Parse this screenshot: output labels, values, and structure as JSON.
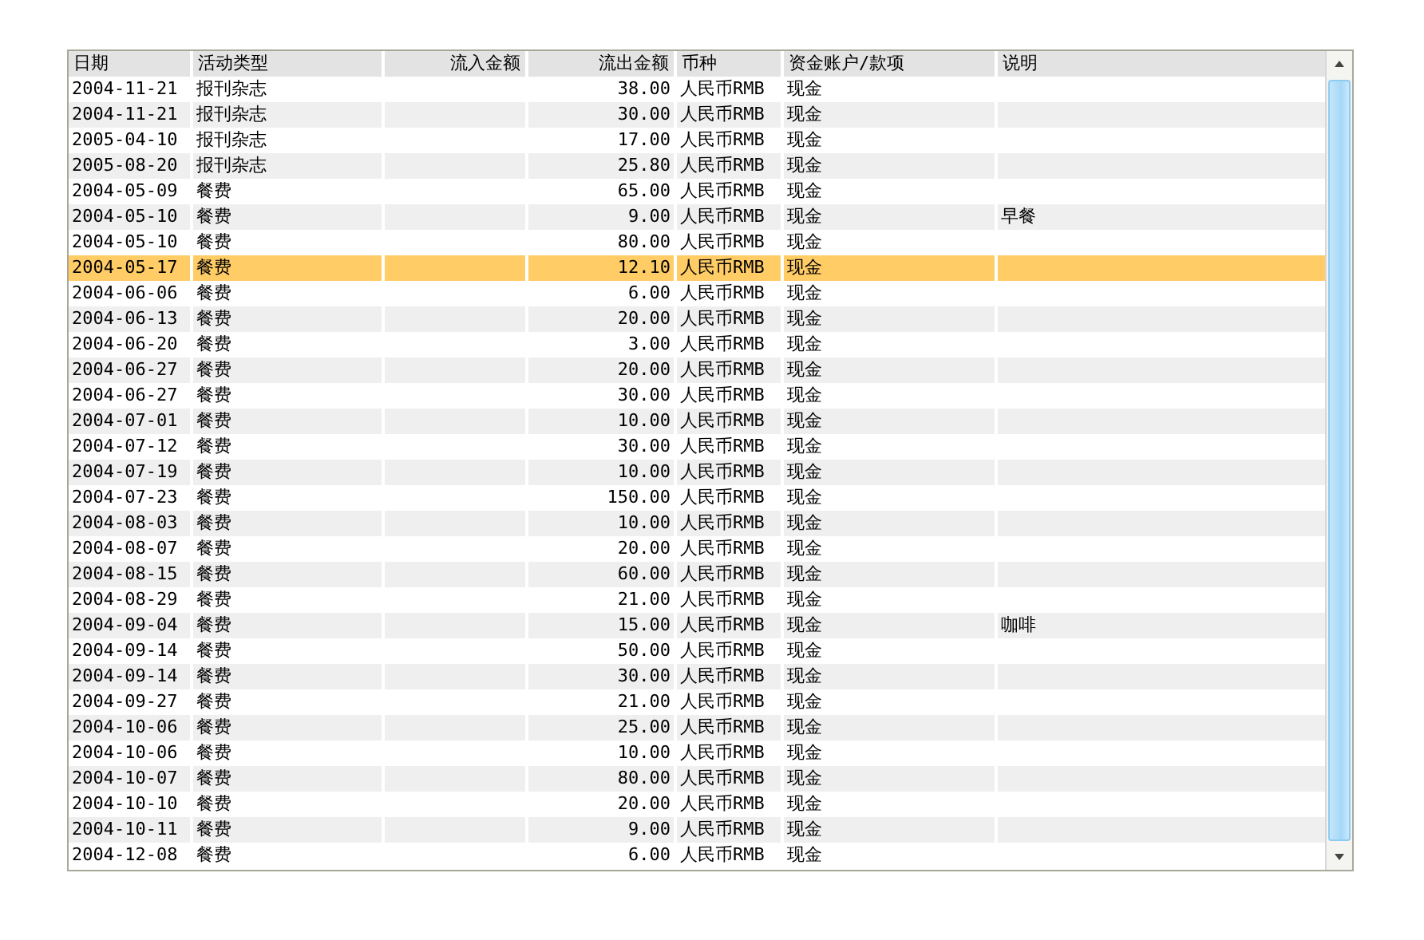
{
  "table": {
    "columns": [
      "日期",
      "活动类型",
      "流入金额",
      "流出金额",
      "币种",
      "资金账户/款项",
      "说明"
    ],
    "rows": [
      {
        "selected": false,
        "date": "2004-11-21",
        "type": "报刊杂志",
        "outflow": "38.00",
        "currency": "人民币RMB",
        "account": "现金"
      },
      {
        "selected": false,
        "date": "2004-11-21",
        "type": "报刊杂志",
        "outflow": "30.00",
        "currency": "人民币RMB",
        "account": "现金"
      },
      {
        "selected": false,
        "date": "2005-04-10",
        "type": "报刊杂志",
        "outflow": "17.00",
        "currency": "人民币RMB",
        "account": "现金"
      },
      {
        "selected": false,
        "date": "2005-08-20",
        "type": "报刊杂志",
        "outflow": "25.80",
        "currency": "人民币RMB",
        "account": "现金"
      },
      {
        "selected": false,
        "date": "2004-05-09",
        "type": "餐费",
        "outflow": "65.00",
        "currency": "人民币RMB",
        "account": "现金"
      },
      {
        "selected": false,
        "date": "2004-05-10",
        "type": "餐费",
        "outflow": "9.00",
        "currency": "人民币RMB",
        "account": "现金",
        "note": "早餐"
      },
      {
        "selected": false,
        "date": "2004-05-10",
        "type": "餐费",
        "outflow": "80.00",
        "currency": "人民币RMB",
        "account": "现金"
      },
      {
        "selected": true,
        "date": "2004-05-17",
        "type": "餐费",
        "outflow": "12.10",
        "currency": "人民币RMB",
        "account": "现金"
      },
      {
        "selected": false,
        "date": "2004-06-06",
        "type": "餐费",
        "outflow": "6.00",
        "currency": "人民币RMB",
        "account": "现金"
      },
      {
        "selected": false,
        "date": "2004-06-13",
        "type": "餐费",
        "outflow": "20.00",
        "currency": "人民币RMB",
        "account": "现金"
      },
      {
        "selected": false,
        "date": "2004-06-20",
        "type": "餐费",
        "outflow": "3.00",
        "currency": "人民币RMB",
        "account": "现金"
      },
      {
        "selected": false,
        "date": "2004-06-27",
        "type": "餐费",
        "outflow": "20.00",
        "currency": "人民币RMB",
        "account": "现金"
      },
      {
        "selected": false,
        "date": "2004-06-27",
        "type": "餐费",
        "outflow": "30.00",
        "currency": "人民币RMB",
        "account": "现金"
      },
      {
        "selected": false,
        "date": "2004-07-01",
        "type": "餐费",
        "outflow": "10.00",
        "currency": "人民币RMB",
        "account": "现金"
      },
      {
        "selected": false,
        "date": "2004-07-12",
        "type": "餐费",
        "outflow": "30.00",
        "currency": "人民币RMB",
        "account": "现金"
      },
      {
        "selected": false,
        "date": "2004-07-19",
        "type": "餐费",
        "outflow": "10.00",
        "currency": "人民币RMB",
        "account": "现金"
      },
      {
        "selected": false,
        "date": "2004-07-23",
        "type": "餐费",
        "outflow": "150.00",
        "currency": "人民币RMB",
        "account": "现金"
      },
      {
        "selected": false,
        "date": "2004-08-03",
        "type": "餐费",
        "outflow": "10.00",
        "currency": "人民币RMB",
        "account": "现金"
      },
      {
        "selected": false,
        "date": "2004-08-07",
        "type": "餐费",
        "outflow": "20.00",
        "currency": "人民币RMB",
        "account": "现金"
      },
      {
        "selected": false,
        "date": "2004-08-15",
        "type": "餐费",
        "outflow": "60.00",
        "currency": "人民币RMB",
        "account": "现金"
      },
      {
        "selected": false,
        "date": "2004-08-29",
        "type": "餐费",
        "outflow": "21.00",
        "currency": "人民币RMB",
        "account": "现金"
      },
      {
        "selected": false,
        "date": "2004-09-04",
        "type": "餐费",
        "outflow": "15.00",
        "currency": "人民币RMB",
        "account": "现金",
        "note": "咖啡"
      },
      {
        "selected": false,
        "date": "2004-09-14",
        "type": "餐费",
        "outflow": "50.00",
        "currency": "人民币RMB",
        "account": "现金"
      },
      {
        "selected": false,
        "date": "2004-09-14",
        "type": "餐费",
        "outflow": "30.00",
        "currency": "人民币RMB",
        "account": "现金"
      },
      {
        "selected": false,
        "date": "2004-09-27",
        "type": "餐费",
        "outflow": "21.00",
        "currency": "人民币RMB",
        "account": "现金"
      },
      {
        "selected": false,
        "date": "2004-10-06",
        "type": "餐费",
        "outflow": "25.00",
        "currency": "人民币RMB",
        "account": "现金"
      },
      {
        "selected": false,
        "date": "2004-10-06",
        "type": "餐费",
        "outflow": "10.00",
        "currency": "人民币RMB",
        "account": "现金"
      },
      {
        "selected": false,
        "date": "2004-10-07",
        "type": "餐费",
        "outflow": "80.00",
        "currency": "人民币RMB",
        "account": "现金"
      },
      {
        "selected": false,
        "date": "2004-10-10",
        "type": "餐费",
        "outflow": "20.00",
        "currency": "人民币RMB",
        "account": "现金"
      },
      {
        "selected": false,
        "date": "2004-10-11",
        "type": "餐费",
        "outflow": "9.00",
        "currency": "人民币RMB",
        "account": "现金"
      },
      {
        "selected": false,
        "date": "2004-12-08",
        "type": "餐费",
        "outflow": "6.00",
        "currency": "人民币RMB",
        "account": "现金"
      }
    ]
  }
}
